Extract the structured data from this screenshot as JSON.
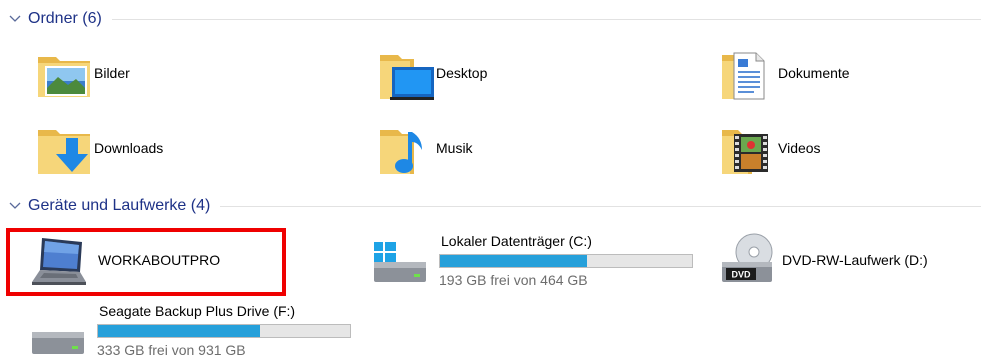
{
  "groups": {
    "folders": {
      "title": "Ordner (6)",
      "items": [
        {
          "label": "Bilder",
          "icon": "folder-pictures-icon"
        },
        {
          "label": "Desktop",
          "icon": "folder-desktop-icon"
        },
        {
          "label": "Dokumente",
          "icon": "folder-documents-icon"
        },
        {
          "label": "Downloads",
          "icon": "folder-downloads-icon"
        },
        {
          "label": "Musik",
          "icon": "folder-music-icon"
        },
        {
          "label": "Videos",
          "icon": "folder-videos-icon"
        }
      ]
    },
    "devices": {
      "title": "Geräte und Laufwerke (4)",
      "items": [
        {
          "label": "WORKABOUTPRO",
          "icon": "laptop-icon"
        },
        {
          "label": "Lokaler Datenträger (C:)",
          "icon": "windows-drive-icon",
          "free_text": "193 GB frei von 464 GB",
          "used_fraction": 0.584
        },
        {
          "label": "DVD-RW-Laufwerk (D:)",
          "icon": "dvd-drive-icon"
        },
        {
          "label": "Seagate Backup Plus Drive (F:)",
          "icon": "external-drive-icon",
          "free_text": "333 GB frei von 931 GB",
          "used_fraction": 0.642
        }
      ]
    }
  },
  "colors": {
    "group_header": "#1e3287",
    "usage_bar_fill": "#26a0da",
    "highlight_border": "#ef0000"
  }
}
